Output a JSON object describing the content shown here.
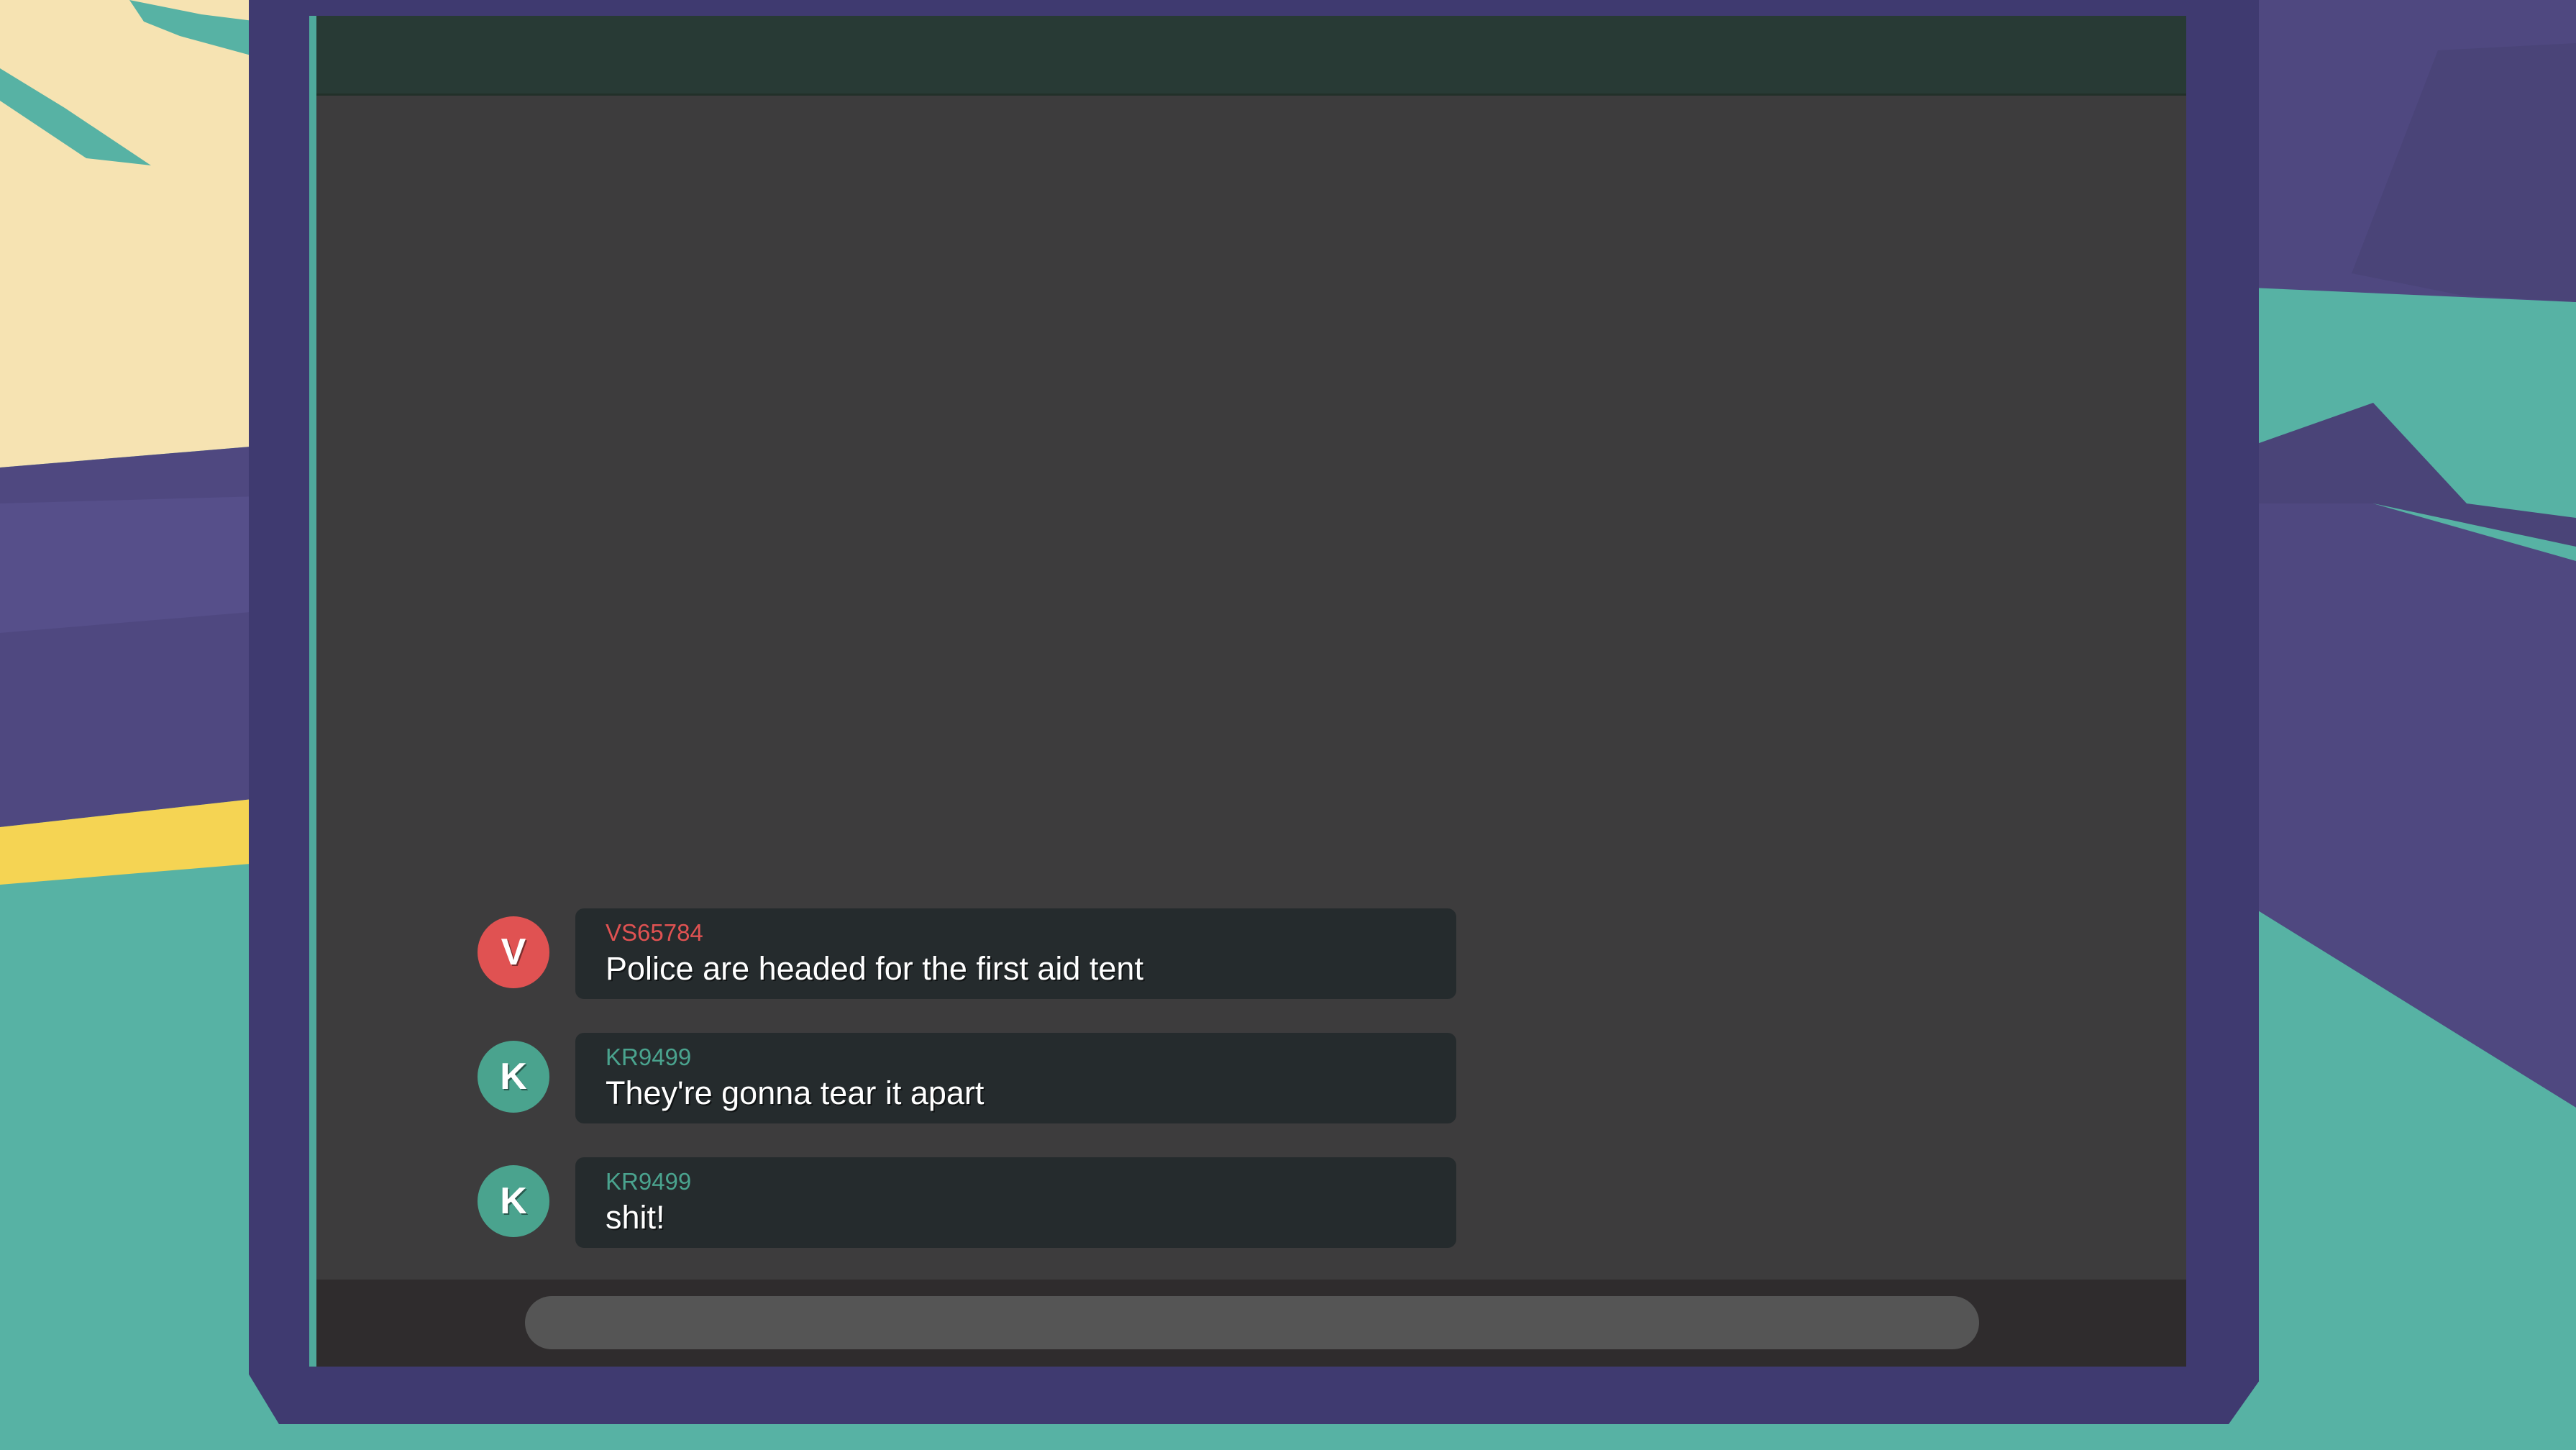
{
  "colors": {
    "ground": "#57b2a4",
    "sky": "#f6e3b2",
    "wall": "#4f4880",
    "stripe": "#f5d453",
    "frame": "#3f3a70",
    "screen_bg": "#3d3c3d",
    "screen_header": "#283a35",
    "bubble_bg": "#252b2d",
    "input_bar": "#2f2c2d",
    "input_field": "#555555"
  },
  "chat": {
    "messages": [
      {
        "avatar_letter": "V",
        "avatar_color": "#e05252",
        "username": "VS65784",
        "username_color": "#e05252",
        "text": "Police are headed for the first aid tent"
      },
      {
        "avatar_letter": "K",
        "avatar_color": "#4aa38e",
        "username": "KR9499",
        "username_color": "#4aa38e",
        "text": "They're gonna tear it apart"
      },
      {
        "avatar_letter": "K",
        "avatar_color": "#4aa38e",
        "username": "KR9499",
        "username_color": "#4aa38e",
        "text": "shit!"
      }
    ],
    "input": {
      "value": "",
      "placeholder": ""
    }
  }
}
